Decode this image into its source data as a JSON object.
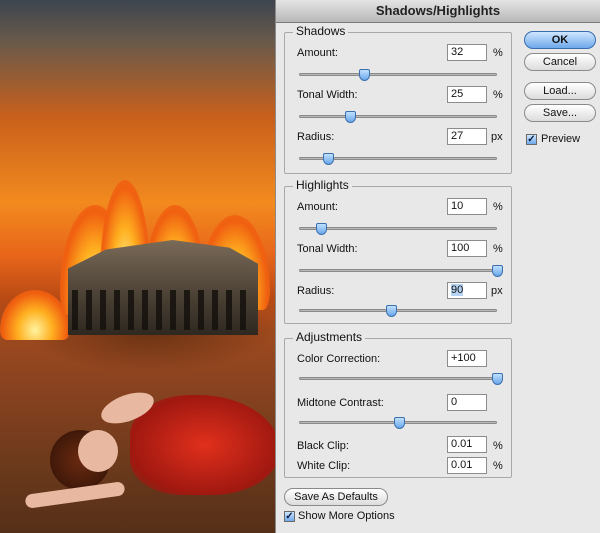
{
  "window": {
    "title": "Shadows/Highlights"
  },
  "shadows": {
    "title": "Shadows",
    "amount": {
      "label": "Amount:",
      "value": "32",
      "unit": "%",
      "slider_pct": 32
    },
    "tonal_width": {
      "label": "Tonal Width:",
      "value": "25",
      "unit": "%",
      "slider_pct": 25
    },
    "radius": {
      "label": "Radius:",
      "value": "27",
      "unit": "px",
      "slider_pct": 14
    }
  },
  "highlights": {
    "title": "Highlights",
    "amount": {
      "label": "Amount:",
      "value": "10",
      "unit": "%",
      "slider_pct": 10
    },
    "tonal_width": {
      "label": "Tonal Width:",
      "value": "100",
      "unit": "%",
      "slider_pct": 100
    },
    "radius": {
      "label": "Radius:",
      "value": "90",
      "unit": "px",
      "slider_pct": 46
    }
  },
  "adjustments": {
    "title": "Adjustments",
    "color_correction": {
      "label": "Color Correction:",
      "value": "+100",
      "slider_pct": 100
    },
    "midtone_contrast": {
      "label": "Midtone Contrast:",
      "value": "0",
      "slider_pct": 50
    },
    "black_clip": {
      "label": "Black Clip:",
      "value": "0.01",
      "unit": "%"
    },
    "white_clip": {
      "label": "White Clip:",
      "value": "0.01",
      "unit": "%"
    }
  },
  "buttons": {
    "ok": "OK",
    "cancel": "Cancel",
    "load": "Load...",
    "save": "Save...",
    "save_defaults": "Save As Defaults"
  },
  "options": {
    "preview": {
      "label": "Preview",
      "checked": true
    },
    "show_more": {
      "label": "Show More Options",
      "checked": true
    }
  },
  "icons": {
    "checkmark": "checkmark-icon",
    "slider_thumb": "slider-thumb-icon"
  }
}
